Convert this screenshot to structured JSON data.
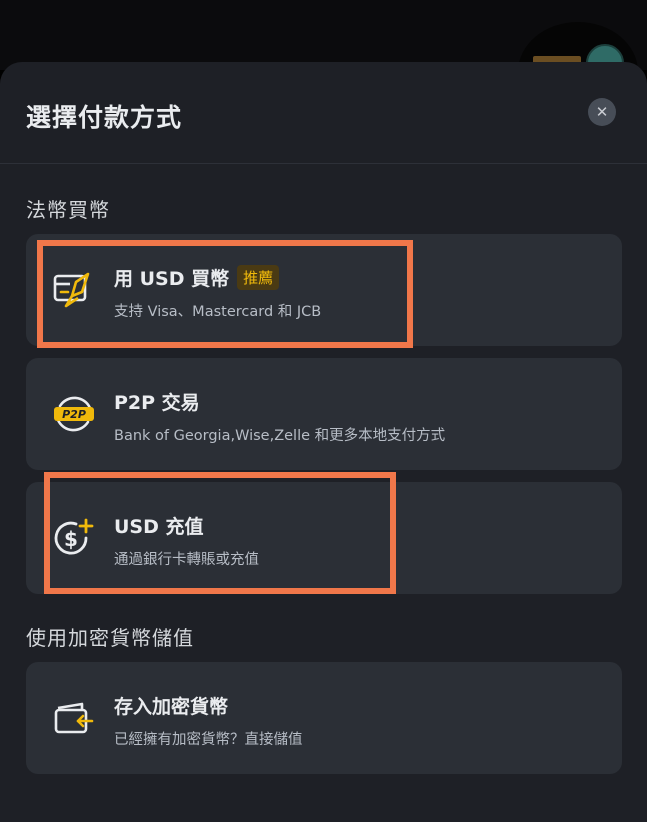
{
  "modal": {
    "title": "選擇付款方式",
    "close_label": "✕"
  },
  "fiat_section": {
    "label": "法幣買幣",
    "options": [
      {
        "title": "用 USD 買幣",
        "badge": "推薦",
        "subtitle": "支持 Visa、Mastercard 和 JCB",
        "icon": "card-rocket-icon"
      },
      {
        "title": "P2P 交易",
        "subtitle": "Bank of Georgia,Wise,Zelle 和更多本地支付方式",
        "icon": "p2p-icon"
      },
      {
        "title": "USD 充值",
        "subtitle": "通過銀行卡轉賬或充值",
        "icon": "dollar-plus-icon"
      }
    ]
  },
  "crypto_section": {
    "label": "使用加密貨幣儲值",
    "options": [
      {
        "title": "存入加密貨幣",
        "subtitle": "已經擁有加密貨幣？直接儲值",
        "icon": "wallet-deposit-icon"
      }
    ]
  },
  "colors": {
    "accent": "#f0b90b",
    "highlight": "#f0774a",
    "sheet_bg": "#1e2026",
    "card_bg": "#2b2f36"
  }
}
